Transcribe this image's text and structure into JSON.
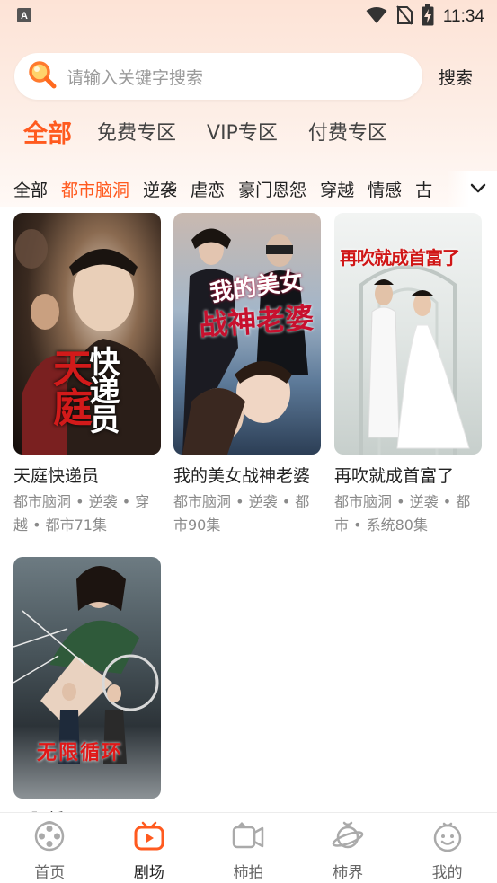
{
  "status_bar": {
    "time": "11:34",
    "icons": [
      "notification-a-icon",
      "wifi-icon",
      "no-sim-icon",
      "battery-charging-icon"
    ]
  },
  "search": {
    "placeholder": "请输入关键字搜索",
    "button_label": "搜索"
  },
  "main_tabs": [
    {
      "label": "全部",
      "active": true
    },
    {
      "label": "免费专区",
      "active": false
    },
    {
      "label": "VIP专区",
      "active": false
    },
    {
      "label": "付费专区",
      "active": false
    }
  ],
  "categories": [
    {
      "label": "全部",
      "active": false
    },
    {
      "label": "都市脑洞",
      "active": true
    },
    {
      "label": "逆袭",
      "active": false
    },
    {
      "label": "虐恋",
      "active": false
    },
    {
      "label": "豪门恩怨",
      "active": false
    },
    {
      "label": "穿越",
      "active": false
    },
    {
      "label": "情感",
      "active": false
    },
    {
      "label": "古",
      "active": false
    }
  ],
  "dramas": [
    {
      "title": "天庭快递员",
      "tags_line1": "都市脑洞 • 逆袭 • 穿",
      "tags_line2": "越 • 都市71集",
      "poster_text": "天庭快递员"
    },
    {
      "title": "我的美女战神老婆",
      "tags_line1": "都市脑洞 • 逆袭 • 都",
      "tags_line2": "市90集",
      "poster_text": "我的美女战神老婆"
    },
    {
      "title": "再吹就成首富了",
      "tags_line1": "都市脑洞 • 逆袭 • 都",
      "tags_line2": "市 • 系统80集",
      "poster_text": "再吹就成首富了"
    },
    {
      "title": "无限循环",
      "tags_line1": "",
      "tags_line2": "",
      "poster_text": "无限循环"
    }
  ],
  "bottom_nav": [
    {
      "label": "首页",
      "icon": "film-reel-icon",
      "active": false
    },
    {
      "label": "剧场",
      "icon": "tv-icon",
      "active": true
    },
    {
      "label": "柿拍",
      "icon": "video-camera-icon",
      "active": false
    },
    {
      "label": "柿界",
      "icon": "planet-icon",
      "active": false
    },
    {
      "label": "我的",
      "icon": "profile-face-icon",
      "active": false
    }
  ],
  "colors": {
    "accent": "#ff5a1f",
    "header_bg": "#fde3d6",
    "muted_text": "#8a8a8a"
  }
}
